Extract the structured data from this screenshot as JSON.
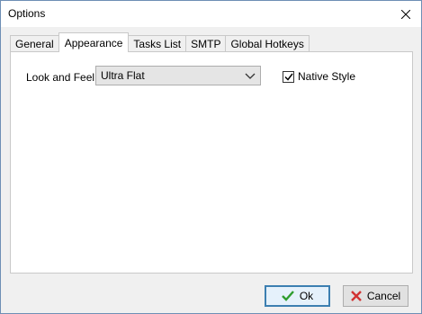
{
  "window": {
    "title": "Options"
  },
  "tabs": [
    {
      "label": "General"
    },
    {
      "label": "Appearance"
    },
    {
      "label": "Tasks List"
    },
    {
      "label": "SMTP"
    },
    {
      "label": "Global Hotkeys"
    }
  ],
  "appearance": {
    "look_and_feel_label": "Look and Feel:",
    "look_and_feel_value": "Ultra Flat",
    "native_style_label": "Native Style",
    "native_style_checked": true
  },
  "buttons": {
    "ok_label": "Ok",
    "cancel_label": "Cancel"
  },
  "colors": {
    "ok_icon": "#2e9d2e",
    "cancel_icon": "#d23232",
    "title_bg": "#ffffff",
    "active_tab_bg": "#ffffff"
  },
  "icons": {
    "close": "close-icon",
    "dropdown": "chevron-down-icon",
    "checkmark": "checkmark-icon",
    "ok": "green-check-icon",
    "cancel": "red-x-icon"
  }
}
